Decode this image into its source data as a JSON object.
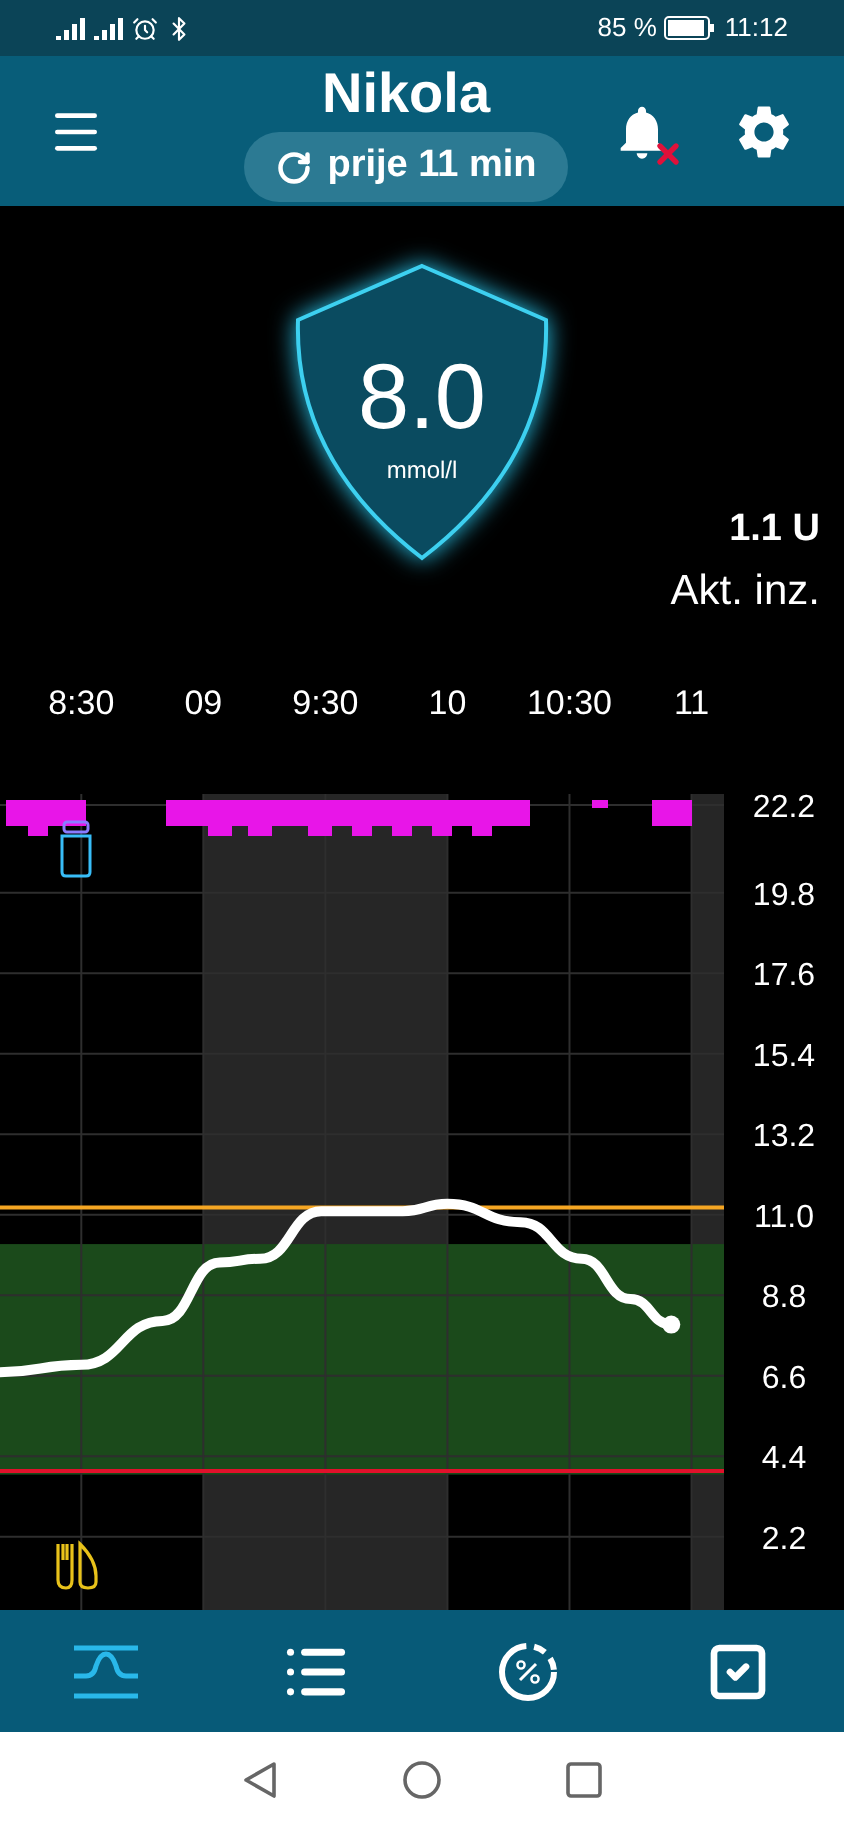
{
  "status_bar": {
    "battery": "85 %",
    "time": "11:12"
  },
  "header": {
    "title": "Nikola",
    "last_update": "prije 11 min"
  },
  "glucose": {
    "value": "8.0",
    "unit": "mmol/l"
  },
  "active_insulin": {
    "amount": "1.1 U",
    "label": "Akt. inz."
  },
  "chart": {
    "chart_data": {
      "type": "line",
      "x": [
        8.167,
        8.5,
        8.833,
        9.067,
        9.233,
        9.483,
        9.817,
        10,
        10.3,
        10.55,
        10.75,
        10.917
      ],
      "series": [
        {
          "color": "#ffffff",
          "values": [
            6.7,
            6.9,
            8.1,
            9.7,
            9.8,
            11.1,
            11.1,
            11.3,
            10.8,
            9.8,
            8.7,
            8.0
          ]
        }
      ],
      "xlim": [
        8.167,
        11.133
      ],
      "ylim": [
        0.2,
        22.5
      ],
      "grid": true,
      "bands": [
        {
          "axis": "y",
          "from": 3.9,
          "to": 10.2,
          "color": "#1b4a1b"
        }
      ],
      "ref_lines": [
        {
          "axis": "y",
          "value": 11.2,
          "color": "#f5a623"
        },
        {
          "axis": "y",
          "value": 4.0,
          "color": "#e0112b"
        }
      ],
      "xticks": [
        {
          "value": 8.5,
          "label": "8:30"
        },
        {
          "value": 9,
          "label": "09"
        },
        {
          "value": 9.5,
          "label": "9:30"
        },
        {
          "value": 10,
          "label": "10"
        },
        {
          "value": 10.5,
          "label": "10:30"
        },
        {
          "value": 11,
          "label": "11"
        }
      ],
      "yticks": [
        {
          "value": 22.2,
          "label": "22.2"
        },
        {
          "value": 19.8,
          "label": "19.8"
        },
        {
          "value": 17.6,
          "label": "17.6"
        },
        {
          "value": 15.4,
          "label": "15.4"
        },
        {
          "value": 13.2,
          "label": "13.2"
        },
        {
          "value": 11.0,
          "label": "11.0"
        },
        {
          "value": 8.8,
          "label": "8.8"
        },
        {
          "value": 6.6,
          "label": "6.6"
        },
        {
          "value": 4.4,
          "label": "4.4"
        },
        {
          "value": 2.2,
          "label": "2.2"
        }
      ]
    }
  },
  "nav_tabs": [
    {
      "kind": "graph",
      "selected": true
    },
    {
      "kind": "list",
      "selected": false
    },
    {
      "kind": "stats",
      "selected": false
    },
    {
      "kind": "tasks",
      "selected": false
    }
  ]
}
